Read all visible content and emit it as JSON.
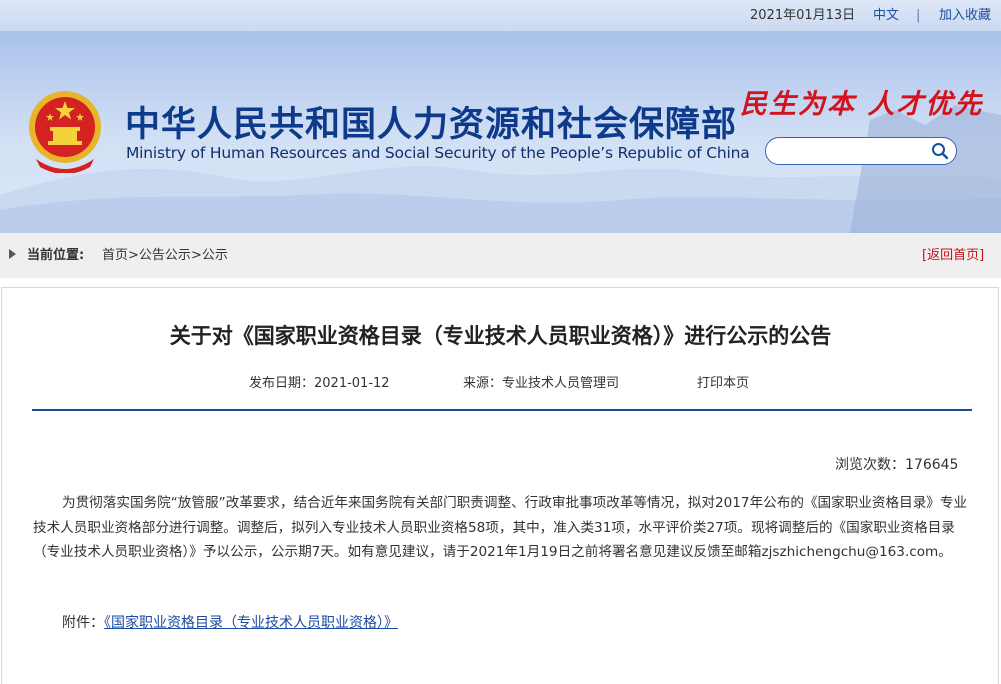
{
  "topbar": {
    "date": "2021年01月13日",
    "lang": "中文",
    "separator": "|",
    "favorite": "加入收藏"
  },
  "header": {
    "ministry_cn": "中华人民共和国人力资源和社会保障部",
    "ministry_en": "Ministry of Human Resources and Social Security of the People’s Republic of China",
    "slogan": "民生为本 人才优先",
    "emblem_icon": "national-emblem-icon",
    "search": {
      "placeholder": "",
      "icon": "search-icon"
    }
  },
  "breadcrumb": {
    "label": "当前位置:",
    "items": [
      "首页",
      "公告公示",
      "公示"
    ],
    "separator": ">",
    "back_link": "[返回首页]"
  },
  "article": {
    "title": "关于对《国家职业资格目录（专业技术人员职业资格）》进行公示的公告",
    "publish_date": "发布日期：2021-01-12",
    "source": "来源：专业技术人员管理司",
    "print": "打印本页",
    "views_label": "浏览次数：",
    "views_count": "176645",
    "paragraph": "为贯彻落实国务院“放管服”改革要求，结合近年来国务院有关部门职责调整、行政审批事项改革等情况，拟对2017年公布的《国家职业资格目录》专业技术人员职业资格部分进行调整。调整后，拟列入专业技术人员职业资格58项，其中，准入类31项，水平评价类27项。现将调整后的《国家职业资格目录（专业技术人员职业资格）》予以公示，公示期7天。如有意见建议，请于2021年1月19日之前将署名意见建议反馈至邮箱zjszhichengchu@163.com。",
    "attachment_label": "附件：",
    "attachment_link": "《国家职业资格目录（专业技术人员职业资格）》"
  },
  "colors": {
    "ministry_blue": "#0d3a8a",
    "slogan_red": "#d3121d",
    "link_blue": "#1b4aa1",
    "divider": "#1a4c8e",
    "back_red": "#c0121c"
  }
}
